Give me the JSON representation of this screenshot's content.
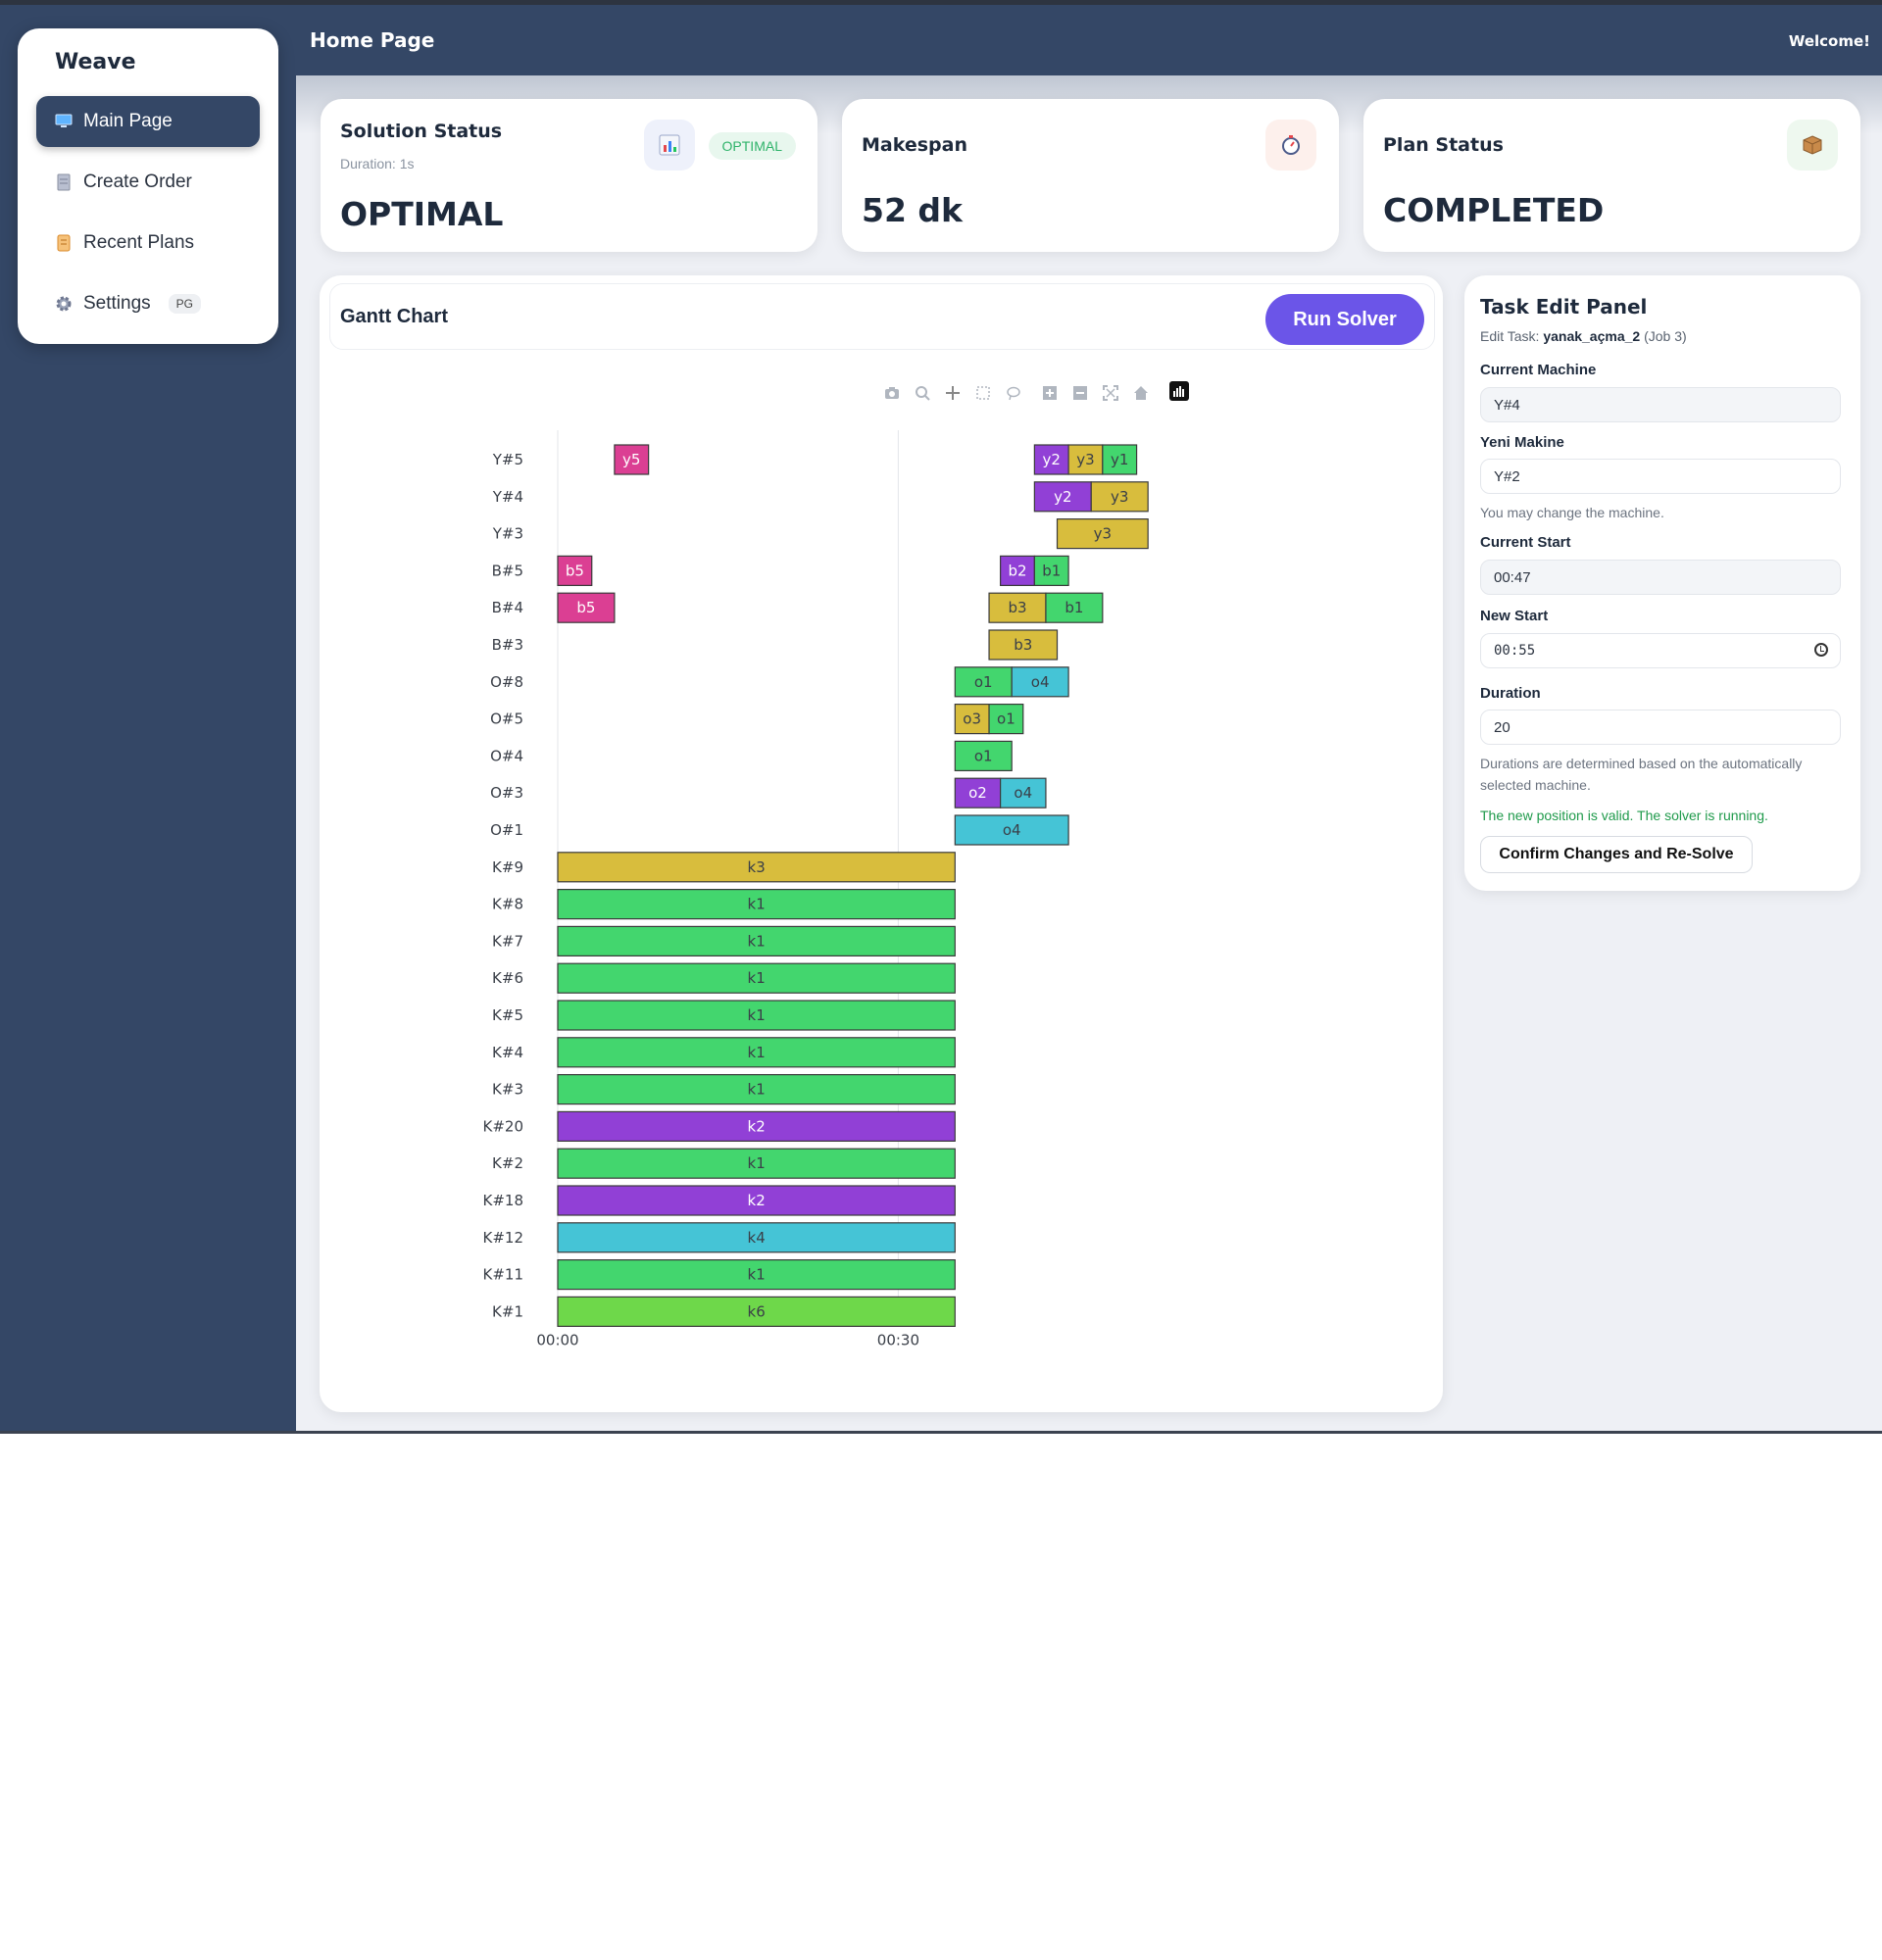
{
  "sidebar": {
    "brand": "Weave",
    "items": [
      {
        "label": "Main Page",
        "icon": "monitor-icon",
        "active": true
      },
      {
        "label": "Create Order",
        "icon": "document-icon",
        "active": false
      },
      {
        "label": "Recent Plans",
        "icon": "scroll-icon",
        "active": false
      },
      {
        "label": "Settings",
        "icon": "gear-icon",
        "active": false,
        "badge": "PG"
      }
    ]
  },
  "header": {
    "title": "Home Page",
    "welcome": "Welcome!"
  },
  "stats": {
    "solution": {
      "title": "Solution Status",
      "sub": "Duration: 1s",
      "badge": "OPTIMAL",
      "value": "OPTIMAL",
      "icon": "bar-chart-icon"
    },
    "makespan": {
      "title": "Makespan",
      "value": "52 dk",
      "icon": "stopwatch-icon"
    },
    "plan": {
      "title": "Plan Status",
      "value": "COMPLETED",
      "icon": "package-icon"
    }
  },
  "gantt": {
    "title": "Gantt Chart",
    "run_label": "Run Solver"
  },
  "panel": {
    "title": "Task Edit Panel",
    "sub_prefix": "Edit Task:",
    "task_name": "yanak_açma_2",
    "job": "(Job 3)",
    "current_machine_label": "Current Machine",
    "current_machine": "Y#4",
    "new_machine_label": "Yeni Makine",
    "new_machine": "Y#2",
    "machine_hint": "You may change the machine.",
    "current_start_label": "Current Start",
    "current_start": "00:47",
    "new_start_label": "New Start",
    "new_start": "00:55",
    "duration_label": "Duration",
    "duration": "20",
    "duration_hint": "Durations are determined based on the automatically selected machine.",
    "valid_msg": "The new position is valid. The solver is running.",
    "confirm_label": "Confirm Changes and Re-Solve"
  },
  "colors": {
    "navy": "#344766",
    "accent": "#6b55e8",
    "success": "#2fb36a"
  },
  "chart_data": {
    "type": "gantt",
    "x_ticks": [
      "00:00",
      "00:30"
    ],
    "x_tick_values": [
      0,
      30
    ],
    "xlim": [
      0,
      52
    ],
    "unit": "minutes",
    "colors": {
      "k1": "#43d66e",
      "k2": "#9140d6",
      "k3": "#d8bd3d",
      "k4": "#45c4d6",
      "k6": "#6ed84a",
      "b1": "#43d66e",
      "b2": "#9140d6",
      "b3": "#d8bd3d",
      "b5": "#db3f93",
      "o1": "#43d66e",
      "o2": "#9140d6",
      "o3": "#d8bd3d",
      "o4": "#45c4d6",
      "y1": "#43d66e",
      "y2": "#9140d6",
      "y3": "#d8bd3d",
      "y5": "#db3f93"
    },
    "rows": [
      "Y#5",
      "Y#4",
      "Y#3",
      "B#5",
      "B#4",
      "B#3",
      "O#8",
      "O#5",
      "O#4",
      "O#3",
      "O#1",
      "K#9",
      "K#8",
      "K#7",
      "K#6",
      "K#5",
      "K#4",
      "K#3",
      "K#20",
      "K#2",
      "K#18",
      "K#12",
      "K#11",
      "K#1"
    ],
    "tasks": [
      {
        "row": "Y#5",
        "label": "y5",
        "start": 5,
        "end": 8
      },
      {
        "row": "Y#5",
        "label": "y2",
        "start": 42,
        "end": 45
      },
      {
        "row": "Y#5",
        "label": "y3",
        "start": 45,
        "end": 48
      },
      {
        "row": "Y#5",
        "label": "y1",
        "start": 48,
        "end": 51
      },
      {
        "row": "Y#4",
        "label": "y2",
        "start": 42,
        "end": 47
      },
      {
        "row": "Y#4",
        "label": "y3",
        "start": 47,
        "end": 52
      },
      {
        "row": "Y#3",
        "label": "y3",
        "start": 44,
        "end": 52
      },
      {
        "row": "B#5",
        "label": "b5",
        "start": 0,
        "end": 3
      },
      {
        "row": "B#5",
        "label": "b2",
        "start": 39,
        "end": 42
      },
      {
        "row": "B#5",
        "label": "b1",
        "start": 42,
        "end": 45
      },
      {
        "row": "B#4",
        "label": "b5",
        "start": 0,
        "end": 5
      },
      {
        "row": "B#4",
        "label": "b3",
        "start": 38,
        "end": 43
      },
      {
        "row": "B#4",
        "label": "b1",
        "start": 43,
        "end": 48
      },
      {
        "row": "B#3",
        "label": "b3",
        "start": 38,
        "end": 44
      },
      {
        "row": "O#8",
        "label": "o1",
        "start": 35,
        "end": 40
      },
      {
        "row": "O#8",
        "label": "o4",
        "start": 40,
        "end": 45
      },
      {
        "row": "O#5",
        "label": "o3",
        "start": 35,
        "end": 38
      },
      {
        "row": "O#5",
        "label": "o1",
        "start": 38,
        "end": 41
      },
      {
        "row": "O#4",
        "label": "o1",
        "start": 35,
        "end": 40
      },
      {
        "row": "O#3",
        "label": "o2",
        "start": 35,
        "end": 39
      },
      {
        "row": "O#3",
        "label": "o4",
        "start": 39,
        "end": 43
      },
      {
        "row": "O#1",
        "label": "o4",
        "start": 35,
        "end": 45
      },
      {
        "row": "K#9",
        "label": "k3",
        "start": 0,
        "end": 35
      },
      {
        "row": "K#8",
        "label": "k1",
        "start": 0,
        "end": 35
      },
      {
        "row": "K#7",
        "label": "k1",
        "start": 0,
        "end": 35
      },
      {
        "row": "K#6",
        "label": "k1",
        "start": 0,
        "end": 35
      },
      {
        "row": "K#5",
        "label": "k1",
        "start": 0,
        "end": 35
      },
      {
        "row": "K#4",
        "label": "k1",
        "start": 0,
        "end": 35
      },
      {
        "row": "K#3",
        "label": "k1",
        "start": 0,
        "end": 35
      },
      {
        "row": "K#20",
        "label": "k2",
        "start": 0,
        "end": 35
      },
      {
        "row": "K#2",
        "label": "k1",
        "start": 0,
        "end": 35
      },
      {
        "row": "K#18",
        "label": "k2",
        "start": 0,
        "end": 35
      },
      {
        "row": "K#12",
        "label": "k4",
        "start": 0,
        "end": 35
      },
      {
        "row": "K#11",
        "label": "k1",
        "start": 0,
        "end": 35
      },
      {
        "row": "K#1",
        "label": "k6",
        "start": 0,
        "end": 35
      }
    ]
  }
}
